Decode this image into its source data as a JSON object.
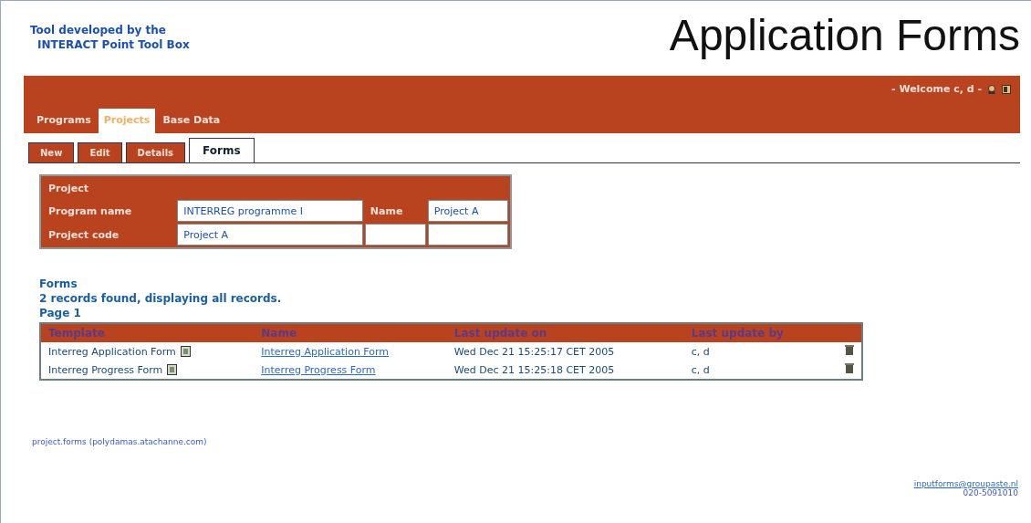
{
  "header": {
    "credit": [
      "Tool developed by the",
      "INTERACT Point Tool Box"
    ],
    "title": "Application Forms",
    "welcome": "- Welcome c, d -"
  },
  "main_tabs": [
    {
      "label": "Programs",
      "selected": false
    },
    {
      "label": "Projects",
      "selected": true
    },
    {
      "label": "Base Data",
      "selected": false
    }
  ],
  "sub_tabs": [
    {
      "label": "New",
      "selected": false
    },
    {
      "label": "Edit",
      "selected": false
    },
    {
      "label": "Details",
      "selected": false
    },
    {
      "label": "Forms",
      "selected": true
    }
  ],
  "project": {
    "title": "Project",
    "rows": [
      [
        "Program name",
        "INTERREG programme I",
        "Name",
        "Project A"
      ],
      [
        "Project code",
        "Project A",
        "",
        ""
      ]
    ]
  },
  "forms": {
    "heading": "Forms",
    "summary": "2 records found, displaying all records.",
    "page": "Page 1",
    "columns": [
      "Template",
      "Name",
      "Last update on",
      "Last update by"
    ],
    "rows": [
      {
        "template": "Interreg Application Form",
        "name": "Interreg Application Form",
        "updated": "Wed Dec 21 15:25:17 CET 2005",
        "by": "c, d"
      },
      {
        "template": "Interreg Progress Form",
        "name": "Interreg Progress Form",
        "updated": "Wed Dec 21 15:25:18 CET 2005",
        "by": "c, d"
      }
    ]
  },
  "footer": {
    "left": "project.forms (polydamas.atachanne.com)",
    "contact": "inputforms@groupaste.nl",
    "phone": "020-5091010"
  }
}
